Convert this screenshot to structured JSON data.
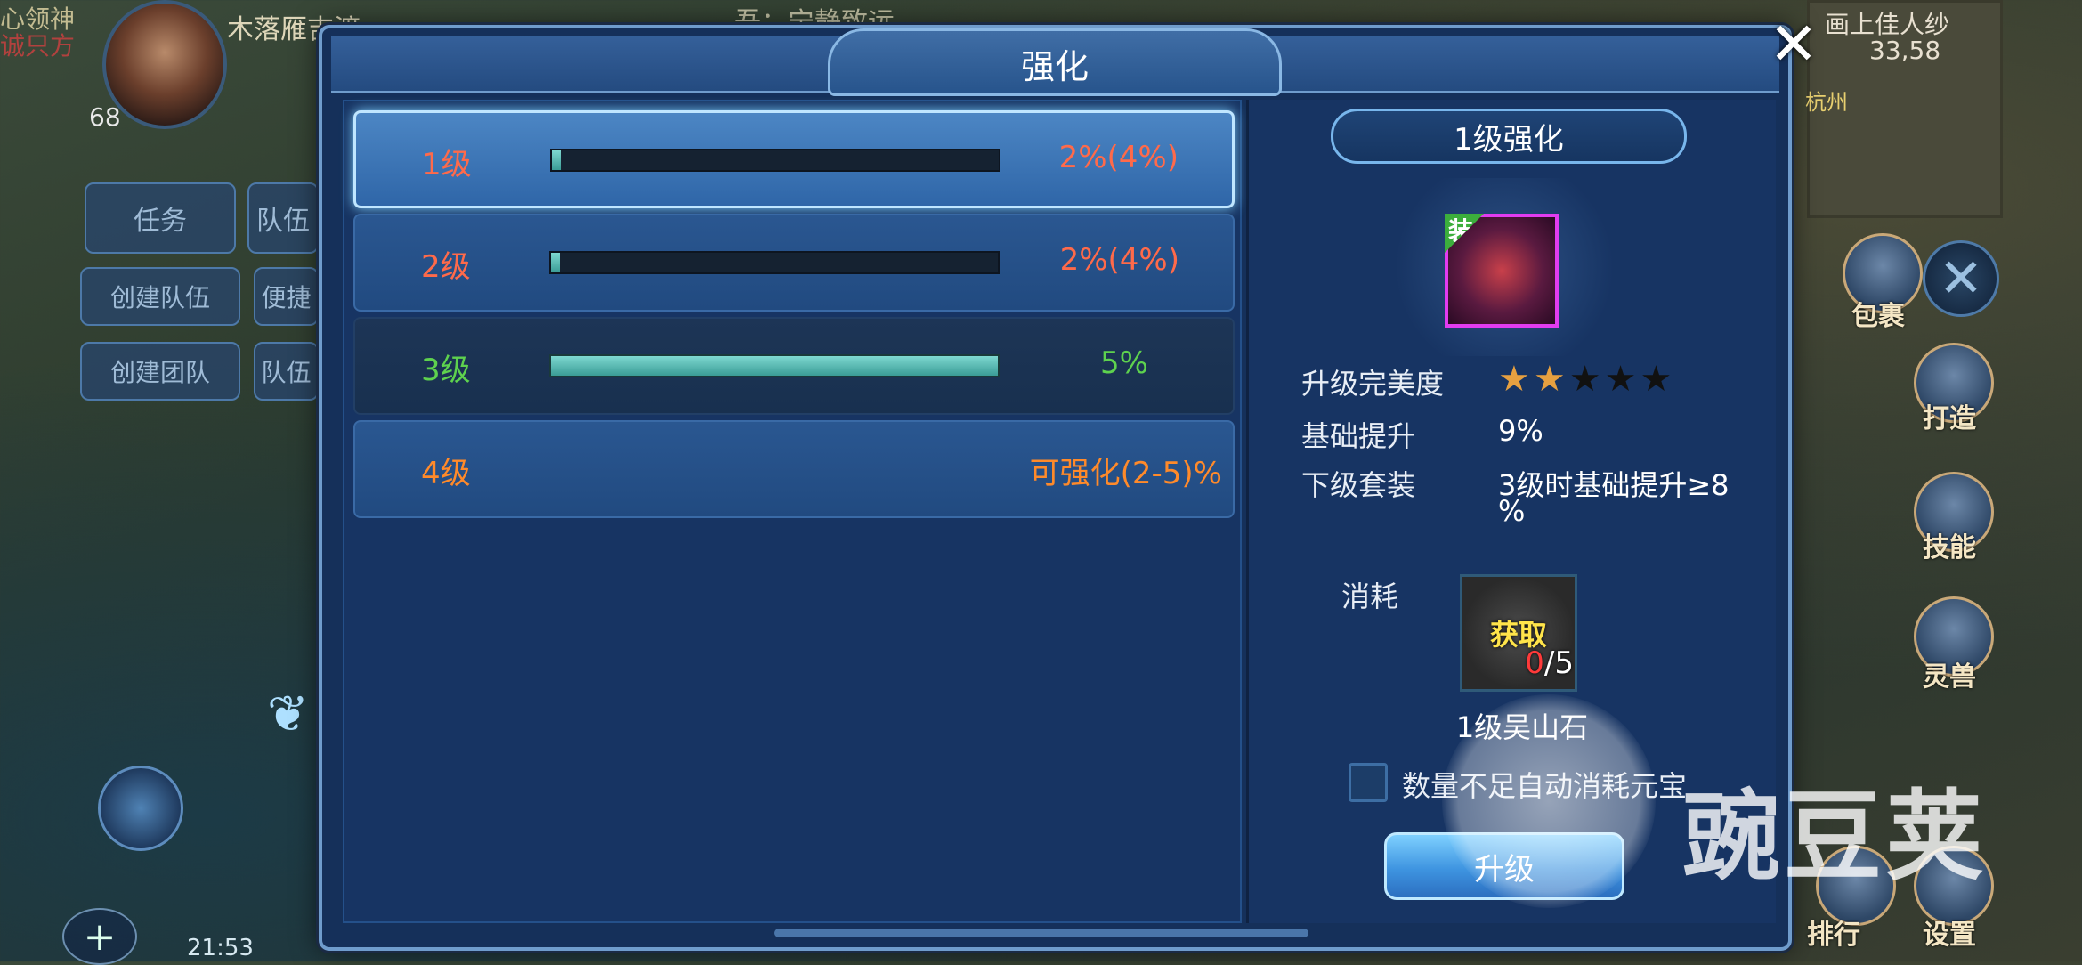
{
  "hud": {
    "top_name": "心领神",
    "top_name2": "诚只方",
    "target_name": "木落雁吉渡",
    "player_level": "68",
    "message": "吾：宁静致远",
    "task_tab": "任务",
    "team_tab": "队伍",
    "create_team": "创建队伍",
    "convenient": "便捷",
    "create_group": "创建团队",
    "team_short": "队伍",
    "time": "21:53",
    "plus": "+",
    "map": {
      "title": "画上佳人纱",
      "coords": "33,58",
      "city": "杭州"
    },
    "side_menu": [
      {
        "label": "包裹",
        "icon": "bag-icon"
      },
      {
        "label": "打造",
        "icon": "hammer-icon"
      },
      {
        "label": "技能",
        "icon": "skill-book-icon"
      },
      {
        "label": "灵兽",
        "icon": "pet-icon"
      },
      {
        "label": "排行",
        "icon": "ranking-icon"
      },
      {
        "label": "设置",
        "icon": "gear-icon"
      }
    ],
    "close_hud": "✕"
  },
  "dialog": {
    "title": "强化",
    "close": "✕",
    "levels": [
      {
        "label": "1级",
        "progress": 0.02,
        "text": "2%(4%)",
        "state": "selected"
      },
      {
        "label": "2级",
        "progress": 0.02,
        "text": "2%(4%)",
        "state": "normal"
      },
      {
        "label": "3级",
        "progress": 1.0,
        "text": "5%",
        "state": "done"
      },
      {
        "label": "4级",
        "progress": null,
        "text": "可强化(2-5)%",
        "state": "available"
      }
    ],
    "detail": {
      "banner": "1级强化",
      "equip_tag": "装",
      "perfection_label": "升级完美度",
      "perfection_stars": 2,
      "perfection_max": 5,
      "base_label": "基础提升",
      "base_value": "9%",
      "next_set_label": "下级套装",
      "next_set_value_line1": "3级时基础提升≥8",
      "next_set_value_line2": "%",
      "consume_label": "消耗",
      "get_text": "获取",
      "have": "0",
      "need": "/5",
      "stone_name": "1级吴山石",
      "auto_consume_label": "数量不足自动消耗元宝",
      "auto_consume_checked": false,
      "upgrade_button": "升级"
    }
  },
  "watermark": "豌豆荚",
  "colors": {
    "selected_row": "#4c86c4",
    "red_text": "#ff6a4a",
    "green_text": "#5ed24e",
    "orange_text": "#ff8a2a",
    "item_border": "#e23cf0",
    "star_on": "#e6a040"
  }
}
